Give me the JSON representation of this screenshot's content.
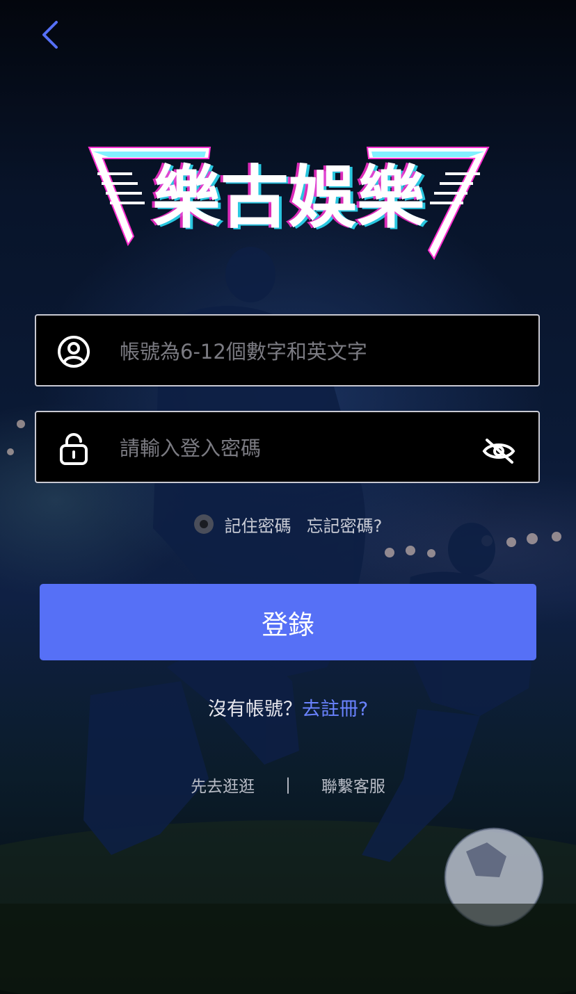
{
  "logo": {
    "text": "樂古娛樂"
  },
  "username": {
    "placeholder": "帳號為6-12個數字和英文字",
    "value": ""
  },
  "password": {
    "placeholder": "請輸入登入密碼",
    "value": ""
  },
  "options": {
    "remember_label": "記住密碼",
    "forgot_label": "忘記密碼?"
  },
  "login": {
    "label": "登錄"
  },
  "register": {
    "prompt": "沒有帳號？",
    "link": "去註冊?"
  },
  "footer": {
    "browse": "先去逛逛",
    "separator": "|",
    "support": "聯繫客服"
  },
  "colors": {
    "accent": "#5670f6",
    "link": "#6a83ff",
    "back_arrow": "#5670f6",
    "logo_magenta": "#ff2fd0",
    "logo_cyan": "#2fe6ff"
  },
  "icons": {
    "back": "chevron-left-icon",
    "user": "user-circle-icon",
    "lock": "lock-icon",
    "eye": "eye-off-icon",
    "radio": "radio-icon"
  }
}
